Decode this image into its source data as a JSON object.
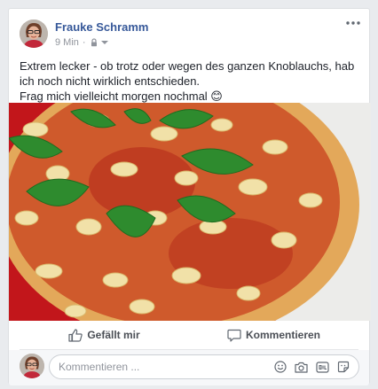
{
  "post": {
    "author": "Frauke Schramm",
    "time": "9 Min",
    "text_line1": "Extrem lecker - ob trotz oder wegen des ganzen Knoblauchs, hab ich noch nicht wirklich entschieden.",
    "text_line2": "Frag mich vielleicht morgen nochmal 😊"
  },
  "actions": {
    "like_label": "Gefällt mir",
    "comment_label": "Kommentieren"
  },
  "comment_box": {
    "placeholder": "Kommentieren ..."
  },
  "icons": {
    "privacy": "lock-icon",
    "audience_dropdown": "chevron-down-icon",
    "more": "more-options-icon",
    "like": "thumbs-up-icon",
    "comment": "speech-bubble-icon",
    "emoji": "emoji-icon",
    "camera": "camera-icon",
    "gif": "gif-icon",
    "sticker": "sticker-icon"
  },
  "colors": {
    "author_link": "#365899",
    "meta_text": "#90949c",
    "action_text": "#4b4f56",
    "page_bg": "#e9ebee"
  }
}
